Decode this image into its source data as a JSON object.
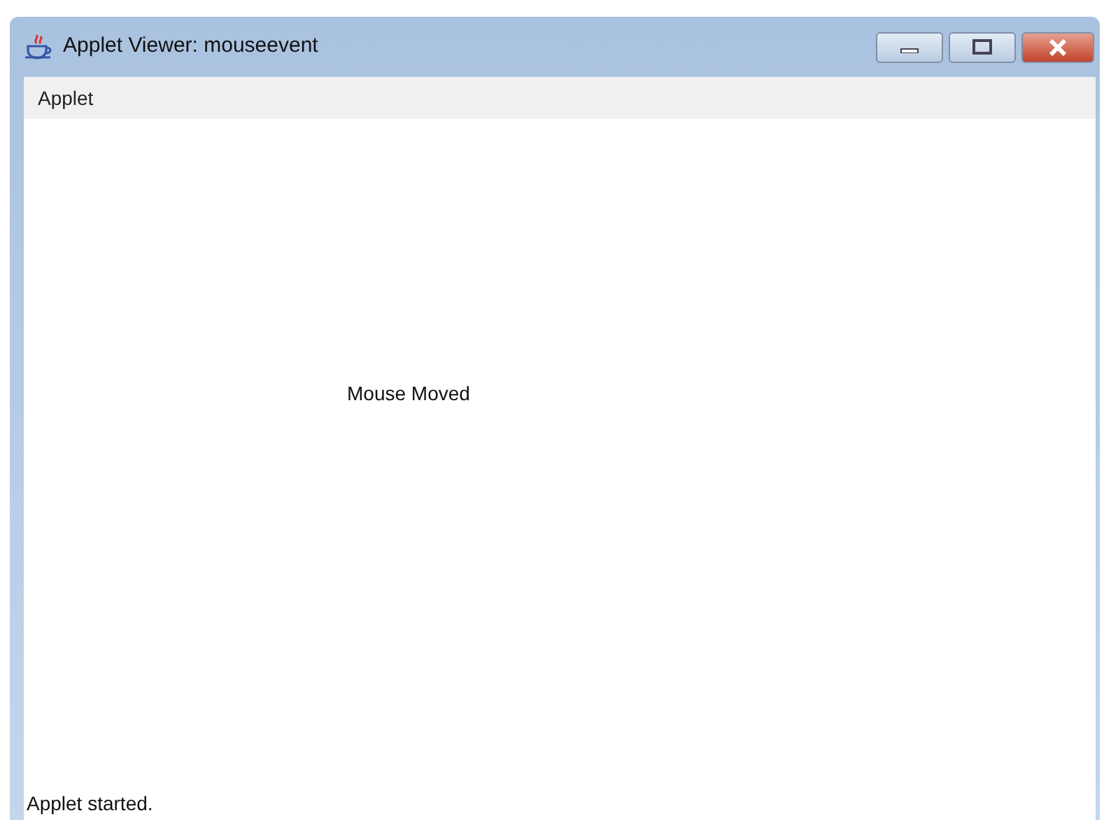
{
  "window": {
    "title": "Applet Viewer: mouseevent"
  },
  "menu_bar": {
    "items": [
      "Applet"
    ]
  },
  "applet": {
    "message": "Mouse Moved"
  },
  "status_bar": {
    "text": "Applet started."
  }
}
